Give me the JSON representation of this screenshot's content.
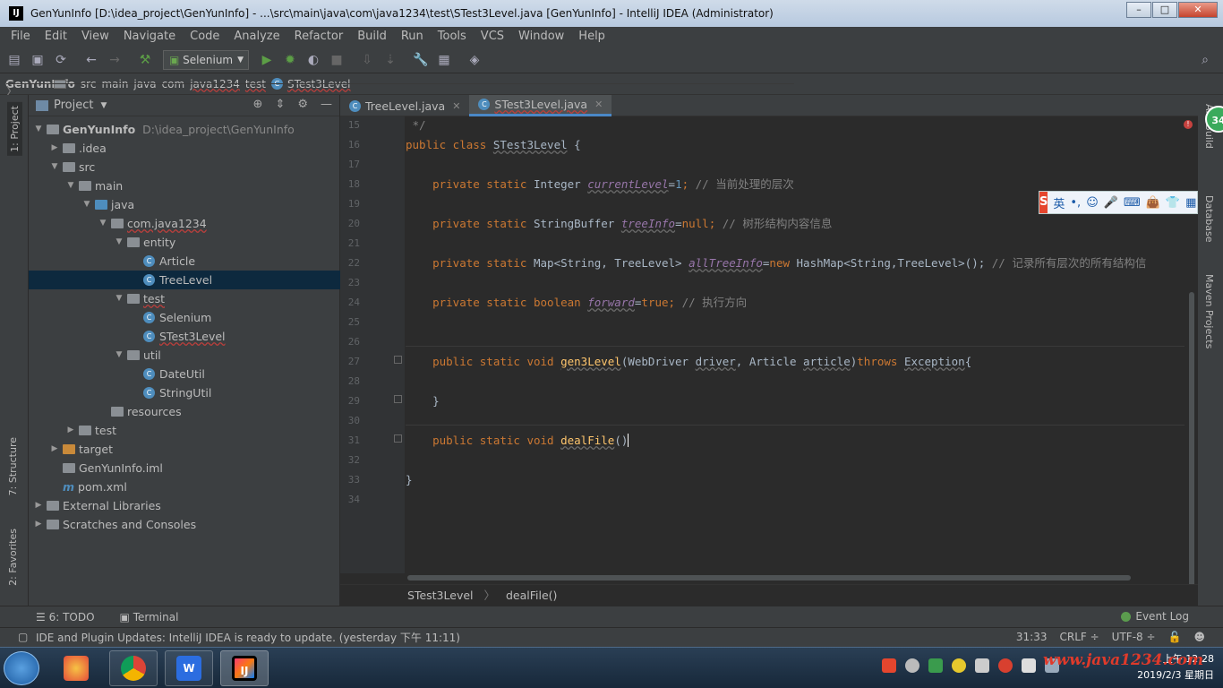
{
  "window": {
    "title": "GenYunInfo [D:\\idea_project\\GenYunInfo] - ...\\src\\main\\java\\com\\java1234\\test\\STest3Level.java [GenYunInfo] - IntelliJ IDEA (Administrator)",
    "app_icon": "IJ",
    "buttons": [
      "–",
      "□",
      "✕"
    ]
  },
  "menu": [
    "File",
    "Edit",
    "View",
    "Navigate",
    "Code",
    "Analyze",
    "Refactor",
    "Build",
    "Run",
    "Tools",
    "VCS",
    "Window",
    "Help"
  ],
  "toolbar": {
    "run_config": "Selenium"
  },
  "breadcrumb": [
    "GenYunInfo",
    "src",
    "main",
    "java",
    "com",
    "java1234",
    "test",
    "STest3Level"
  ],
  "left_tabs": [
    "1: Project",
    "7: Structure",
    "2: Favorites"
  ],
  "project_panel": {
    "title": "Project",
    "tree": [
      {
        "label": "GenYunInfo",
        "path": "D:\\idea_project\\GenYunInfo",
        "depth": 0,
        "arrow": "▼",
        "icon": "module",
        "bold": true
      },
      {
        "label": ".idea",
        "depth": 1,
        "arrow": "▶",
        "icon": "folder"
      },
      {
        "label": "src",
        "depth": 1,
        "arrow": "▼",
        "icon": "folder"
      },
      {
        "label": "main",
        "depth": 2,
        "arrow": "▼",
        "icon": "folder"
      },
      {
        "label": "java",
        "depth": 3,
        "arrow": "▼",
        "icon": "folder-blue"
      },
      {
        "label": "com.java1234",
        "depth": 4,
        "arrow": "▼",
        "icon": "package",
        "error": true
      },
      {
        "label": "entity",
        "depth": 5,
        "arrow": "▼",
        "icon": "package"
      },
      {
        "label": "Article",
        "depth": 6,
        "arrow": "",
        "icon": "class"
      },
      {
        "label": "TreeLevel",
        "depth": 6,
        "arrow": "",
        "icon": "class",
        "selected": true
      },
      {
        "label": "test",
        "depth": 5,
        "arrow": "▼",
        "icon": "package",
        "error": true
      },
      {
        "label": "Selenium",
        "depth": 6,
        "arrow": "",
        "icon": "class"
      },
      {
        "label": "STest3Level",
        "depth": 6,
        "arrow": "",
        "icon": "class",
        "error": true
      },
      {
        "label": "util",
        "depth": 5,
        "arrow": "▼",
        "icon": "package"
      },
      {
        "label": "DateUtil",
        "depth": 6,
        "arrow": "",
        "icon": "class"
      },
      {
        "label": "StringUtil",
        "depth": 6,
        "arrow": "",
        "icon": "class"
      },
      {
        "label": "resources",
        "depth": 4,
        "arrow": "",
        "icon": "folder"
      },
      {
        "label": "test",
        "depth": 2,
        "arrow": "▶",
        "icon": "folder"
      },
      {
        "label": "target",
        "depth": 1,
        "arrow": "▶",
        "icon": "folder-orange"
      },
      {
        "label": "GenYunInfo.iml",
        "depth": 1,
        "arrow": "",
        "icon": "file"
      },
      {
        "label": "pom.xml",
        "depth": 1,
        "arrow": "",
        "icon": "maven"
      },
      {
        "label": "External Libraries",
        "depth": 0,
        "arrow": "▶",
        "icon": "libs"
      },
      {
        "label": "Scratches and Consoles",
        "depth": 0,
        "arrow": "▶",
        "icon": "scratch"
      }
    ]
  },
  "editor": {
    "tabs": [
      {
        "label": "TreeLevel.java",
        "active": false
      },
      {
        "label": "STest3Level.java",
        "active": true
      }
    ],
    "line_numbers": [
      "15",
      "16",
      "17",
      "18",
      "19",
      "20",
      "21",
      "22",
      "23",
      "24",
      "25",
      "26",
      "27",
      "28",
      "29",
      "30",
      "31",
      "32",
      "33",
      "34"
    ],
    "lines": {
      "l15": " */",
      "l16_kw": "public class ",
      "l16_name": "STest3Level",
      "l16_rest": " {",
      "l18_kw": "    private static ",
      "l18_type": "Integer ",
      "l18_fld": "currentLevel",
      "l18_eq": "=",
      "l18_num": "1",
      "l18_semi": "; ",
      "l18_cm": "// 当前处理的层次",
      "l20_kw": "    private static ",
      "l20_type": "StringBuffer ",
      "l20_fld": "treeInfo",
      "l20_eq": "=",
      "l20_val": "null",
      "l20_semi": "; ",
      "l20_cm": "// 树形结构内容信息",
      "l22_kw": "    private static ",
      "l22_type": "Map<String, TreeLevel> ",
      "l22_fld": "allTreeInfo",
      "l22_eq": "=",
      "l22_new": "new ",
      "l22_rest": "HashMap<String,TreeLevel>(); ",
      "l22_cm": "// 记录所有层次的所有结构信",
      "l24_kw": "    private static boolean ",
      "l24_fld": "forward",
      "l24_eq": "=",
      "l24_val": "true",
      "l24_semi": "; ",
      "l24_cm": "// 执行方向",
      "l27_kw": "    public static void ",
      "l27_name": "gen3Level",
      "l27_p1": "(WebDriver ",
      "l27_a1": "driver",
      "l27_p2": ", Article ",
      "l27_a2": "article",
      "l27_p3": ")",
      "l27_throws": "throws ",
      "l27_ex": "Exception",
      "l27_end": "{",
      "l29": "    }",
      "l31_kw": "    public static void ",
      "l31_name": "dealFile",
      "l31_rest": "()",
      "l33": "}"
    },
    "breadcrumb": [
      "STest3Level",
      "dealFile()"
    ]
  },
  "right_tabs": [
    "Ant Build",
    "Database",
    "Maven Projects"
  ],
  "badge": "34",
  "ime_bar": {
    "logo": "S",
    "mode": "英"
  },
  "bottom_tools": {
    "todo": "6: TODO",
    "terminal": "Terminal",
    "event_log": "Event Log"
  },
  "status": {
    "message": "IDE and Plugin Updates: IntelliJ IDEA is ready to update. (yesterday 下午 11:11)",
    "position": "31:33",
    "line_sep": "CRLF ÷",
    "encoding": "UTF-8 ÷"
  },
  "taskbar": {
    "time": "上午 12:28",
    "date": "2019/2/3 星期日",
    "watermark": "www.java1234.com"
  }
}
